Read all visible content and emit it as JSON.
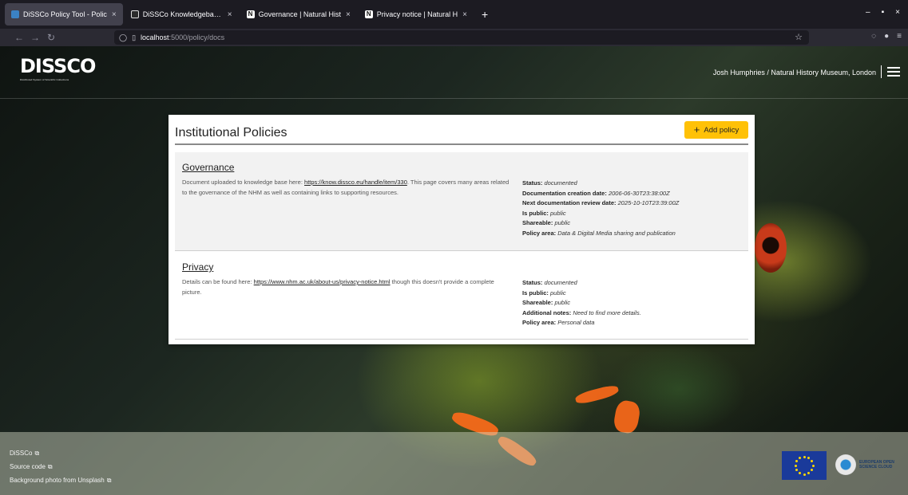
{
  "browser": {
    "tabs": [
      {
        "title": "DiSSCo Policy Tool - Polic",
        "active": true,
        "icon": "blue-square-icon"
      },
      {
        "title": "DiSSCo Knowledgebase: (",
        "active": false,
        "icon": "dissco-favicon-icon"
      },
      {
        "title": "Governance | Natural Hist",
        "active": false,
        "icon": "nhm-favicon-icon"
      },
      {
        "title": "Privacy notice | Natural H",
        "active": false,
        "icon": "nhm-favicon-icon"
      }
    ],
    "close_glyph": "×",
    "newtab_glyph": "+",
    "url_host": "localhost",
    "url_path": ":5000/policy/docs"
  },
  "header": {
    "logo_word": "DISSCO",
    "logo_tagline": "Distributed System of Scientific Collections",
    "user": "Josh Humphries / Natural History Museum, London"
  },
  "card": {
    "title": "Institutional Policies",
    "add_label": "Add policy",
    "policies": [
      {
        "title": "Governance",
        "desc_before": "Document uploaded to knowledge base here: ",
        "link": "https://know.dissco.eu/handle/item/330",
        "desc_after": ". This page covers many areas related to the governance of the NHM as well as containing links to supporting resources.",
        "meta": [
          {
            "label": "Status:",
            "value": "documented"
          },
          {
            "label": "Documentation creation date:",
            "value": "2006-06-30T23:38:00Z"
          },
          {
            "label": "Next documentation review date:",
            "value": "2025-10-10T23:39:00Z"
          },
          {
            "label": "Is public:",
            "value": "public"
          },
          {
            "label": "Shareable:",
            "value": "public"
          },
          {
            "label": "Policy area:",
            "value": "Data & Digital Media sharing and publication"
          }
        ]
      },
      {
        "title": "Privacy",
        "desc_before": "Details can be found here: ",
        "link": "https://www.nhm.ac.uk/about-us/privacy-notice.html",
        "desc_after": " though this doesn't provide a complete picture.",
        "meta": [
          {
            "label": "Status:",
            "value": "documented"
          },
          {
            "label": "Is public:",
            "value": "public"
          },
          {
            "label": "Shareable:",
            "value": "public"
          },
          {
            "label": "Additional notes:",
            "value": "Need to find more details."
          },
          {
            "label": "Policy area:",
            "value": "Personal data"
          }
        ]
      }
    ]
  },
  "footer": {
    "links": [
      "DiSSCo",
      "Source code",
      "Background photo from Unsplash"
    ],
    "eosc_line1": "EUROPEAN OPEN",
    "eosc_line2": "SCIENCE CLOUD"
  },
  "colors": {
    "accent_button": "#ffc107",
    "browser_bg": "#1c1b22",
    "card_bg": "#ffffff"
  }
}
